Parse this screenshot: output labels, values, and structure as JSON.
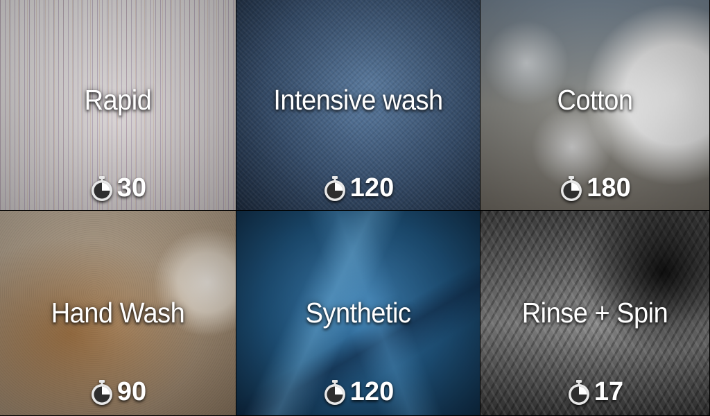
{
  "programs": [
    {
      "name": "Rapid",
      "duration": "30",
      "image": "striped-shirt"
    },
    {
      "name": "Intensive wash",
      "duration": "120",
      "image": "denim"
    },
    {
      "name": "Cotton",
      "duration": "180",
      "image": "cotton-boll"
    },
    {
      "name": "Hand Wash",
      "duration": "90",
      "image": "stained-carpet"
    },
    {
      "name": "Synthetic",
      "duration": "120",
      "image": "blue-satin"
    },
    {
      "name": "Rinse + Spin",
      "duration": "17",
      "image": "washer-drum"
    }
  ],
  "icons": {
    "duration": "timer-icon"
  },
  "colors": {
    "text": "#ffffff",
    "background": "#000000"
  }
}
